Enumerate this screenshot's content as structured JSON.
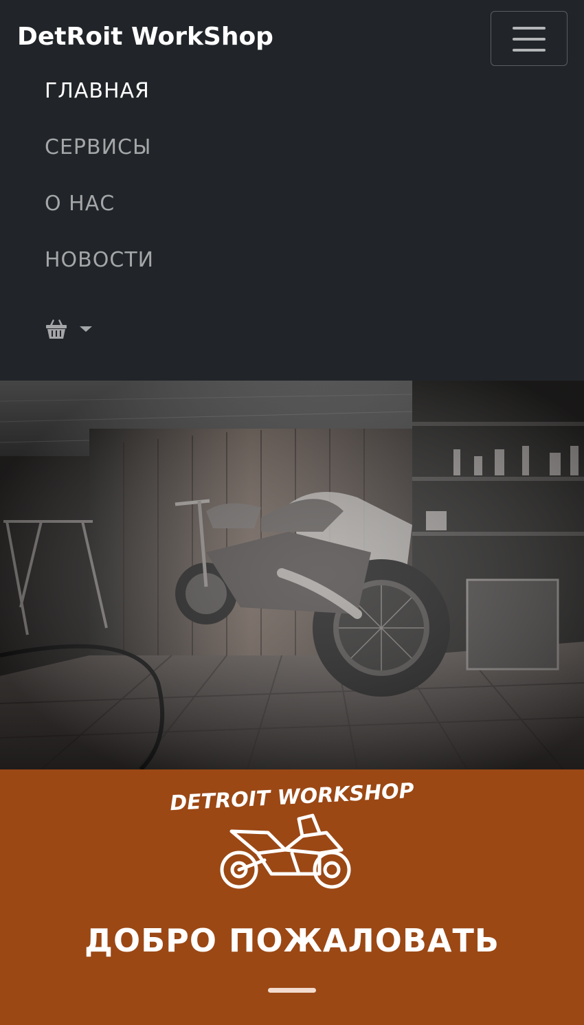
{
  "navbar": {
    "brand": "DetRoit WorkShop",
    "toggler_icon": "hamburger-icon",
    "items": [
      {
        "label": "ГЛАВНАЯ",
        "active": true
      },
      {
        "label": "СЕРВИСЫ",
        "active": false
      },
      {
        "label": "О НАС",
        "active": false
      },
      {
        "label": "НОВОСТИ",
        "active": false
      }
    ],
    "cart_icon": "basket-icon",
    "cart_dropdown_icon": "caret-down-icon"
  },
  "hero": {
    "image": "garage-motorcycle-photo"
  },
  "welcome": {
    "logo_text": "DETROIT WORKSHOP",
    "logo_icon": "motorcycle-icon",
    "title": "ДОБРО ПОЖАЛОВАТЬ"
  },
  "colors": {
    "navbar_bg": "#212529",
    "accent_bg": "#9b4815",
    "nav_active": "#ffffff",
    "nav_inactive": "#a4a6a8"
  }
}
